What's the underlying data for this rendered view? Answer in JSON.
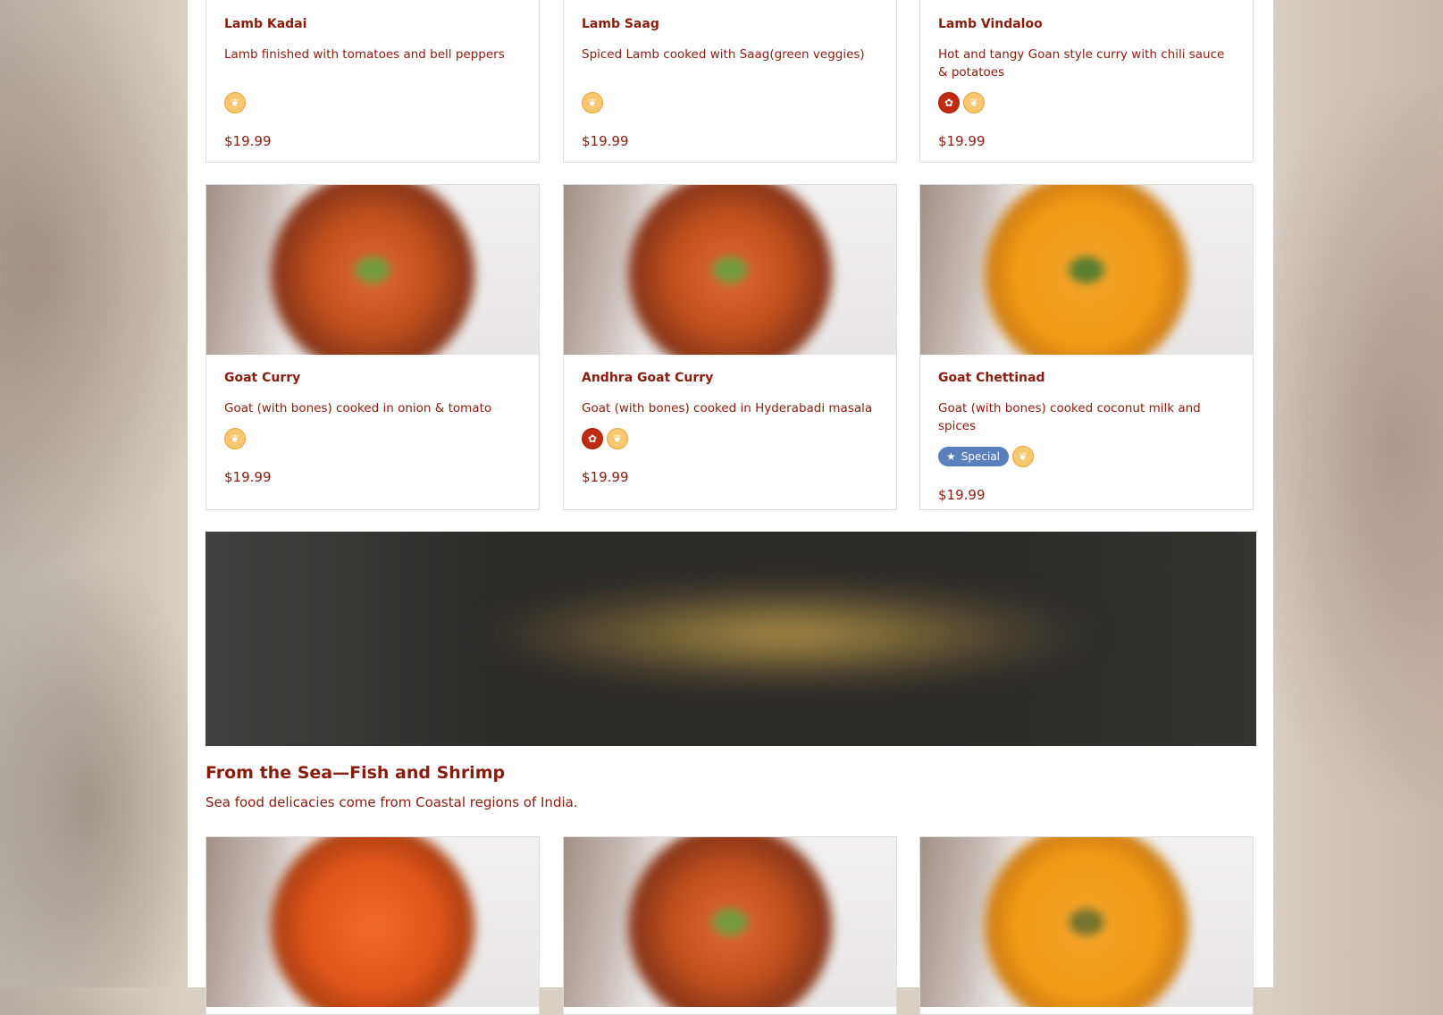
{
  "row1": [
    {
      "name": "Lamb Kadai",
      "desc": "Lamb finished with tomatoes and bell peppers",
      "price": "$19.99",
      "spicy": false,
      "special": false
    },
    {
      "name": "Lamb Saag",
      "desc": "Spiced Lamb cooked with Saag(green veggies)",
      "price": "$19.99",
      "spicy": false,
      "special": false
    },
    {
      "name": "Lamb Vindaloo",
      "desc": "Hot and tangy Goan style curry with chili sauce & potatoes",
      "price": "$19.99",
      "spicy": true,
      "special": false
    }
  ],
  "row2": [
    {
      "name": "Goat Curry",
      "desc": "Goat (with bones) cooked in onion & tomato",
      "price": "$19.99",
      "spicy": false,
      "special": false
    },
    {
      "name": "Andhra Goat Curry",
      "desc": "Goat (with bones) cooked in Hyderabadi masala",
      "price": "$19.99",
      "spicy": true,
      "special": false
    },
    {
      "name": "Goat Chettinad",
      "desc": "Goat (with bones) cooked coconut milk and spices",
      "price": "$19.99",
      "spicy": false,
      "special": true,
      "special_label": "Special"
    }
  ],
  "section": {
    "title": "From the Sea—Fish and Shrimp",
    "subtitle": "Sea food delicacies come from Coastal regions of India."
  },
  "icons": {
    "gluten_free": "gluten-free-icon",
    "spicy": "chili-icon",
    "special": "star-icon"
  },
  "colors": {
    "accent": "#8a1c0e",
    "special_badge": "#5a7fbd",
    "gluten_free": "#f7c870",
    "spicy": "#c02a10"
  }
}
